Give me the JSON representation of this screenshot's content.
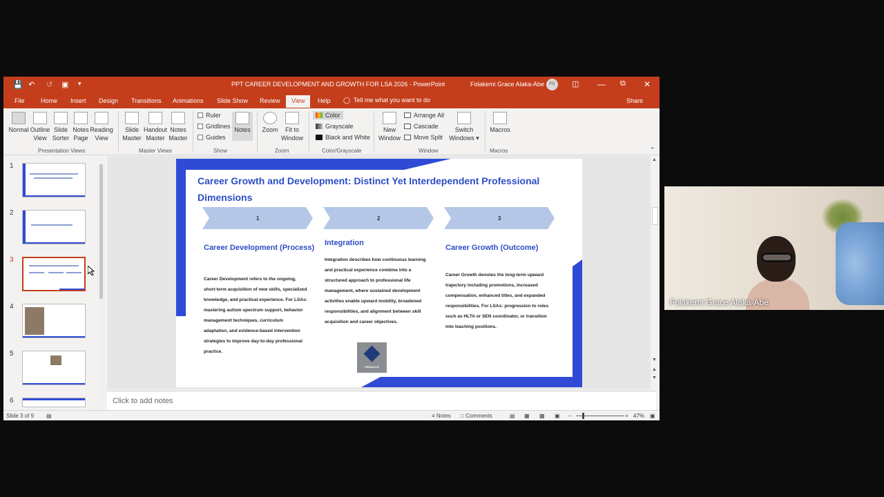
{
  "window": {
    "title": "PPT CAREER DEVELOPMENT AND GROWTH FOR LSA 2026  -  PowerPoint",
    "user_name": "Folakemi Grace Alaka-Abe",
    "user_initials": "FG",
    "accent_color": "#c43e1c"
  },
  "menu": {
    "tabs": [
      "File",
      "Home",
      "Insert",
      "Design",
      "Transitions",
      "Animations",
      "Slide Show",
      "Review",
      "View",
      "Help"
    ],
    "active_tab": "View",
    "tell_me": "Tell me what you want to do",
    "share": "Share"
  },
  "ribbon": {
    "presentation_views": {
      "label": "Presentation Views",
      "buttons": [
        [
          "Normal",
          ""
        ],
        [
          "Outline",
          "View"
        ],
        [
          "Slide",
          "Sorter"
        ],
        [
          "Notes",
          "Page"
        ],
        [
          "Reading",
          "View"
        ]
      ]
    },
    "master_views": {
      "label": "Master Views",
      "buttons": [
        [
          "Slide",
          "Master"
        ],
        [
          "Handout",
          "Master"
        ],
        [
          "Notes",
          "Master"
        ]
      ]
    },
    "show": {
      "label": "Show",
      "checkboxes": [
        "Ruler",
        "Gridlines",
        "Guides"
      ],
      "notes": "Notes"
    },
    "zoom": {
      "label": "Zoom",
      "buttons": [
        [
          "Zoom",
          ""
        ],
        [
          "Fit to",
          "Window"
        ]
      ]
    },
    "color": {
      "label": "Color/Grayscale",
      "options": [
        "Color",
        "Grayscale",
        "Black and White"
      ]
    },
    "window": {
      "label": "Window",
      "new_window": [
        "New",
        "Window"
      ],
      "arrange_all": "Arrange All",
      "cascade": "Cascade",
      "move_split": "Move Split",
      "switch_windows": [
        "Switch",
        "Windows"
      ]
    },
    "macros": {
      "label": "Macros",
      "button": "Macros"
    }
  },
  "thumbnails": {
    "numbers": [
      "1",
      "2",
      "3",
      "4",
      "5",
      "6"
    ],
    "selected": "3"
  },
  "slide": {
    "title": "Career Growth and Development: Distinct Yet Interdependent Professional Dimensions",
    "steps": [
      "1",
      "2",
      "3"
    ],
    "columns": [
      {
        "heading": "Career Development (Process)",
        "body": "Career Development refers to the ongoing, short-term acquisition of new skills, specialized knowledge, and practical experience. For LSAs: mastering autism spectrum support, behavior management techniques, curriculum adaptation, and evidence-based intervention strategies to improve day-to-day professional practice."
      },
      {
        "heading": "Integration",
        "body": "Integration describes how continuous learning and practical experience combine into a structured approach to professional life management, where sustained development activities enable upward mobility, broadened responsibilities, and alignment between skill acquisition and career objectives."
      },
      {
        "heading": "Career Growth (Outcome)",
        "body": "Career Growth denotes the long-term upward trajectory including promotions, increased compensation, enhanced titles, and expanded responsibilities. For LSAs: progression to roles such as HLTA or SEN coordinator, or transition into teaching positions."
      }
    ],
    "logo_text": "PINNACLE",
    "slide_blue": "#2f4bd6"
  },
  "notes": {
    "placeholder": "Click to add notes"
  },
  "status": {
    "slide_counter": "Slide 3 of 9",
    "notes": "Notes",
    "comments": "Comments",
    "zoom": "47%"
  },
  "video": {
    "participant": "Folakemi Grace Alaka-Abe"
  }
}
